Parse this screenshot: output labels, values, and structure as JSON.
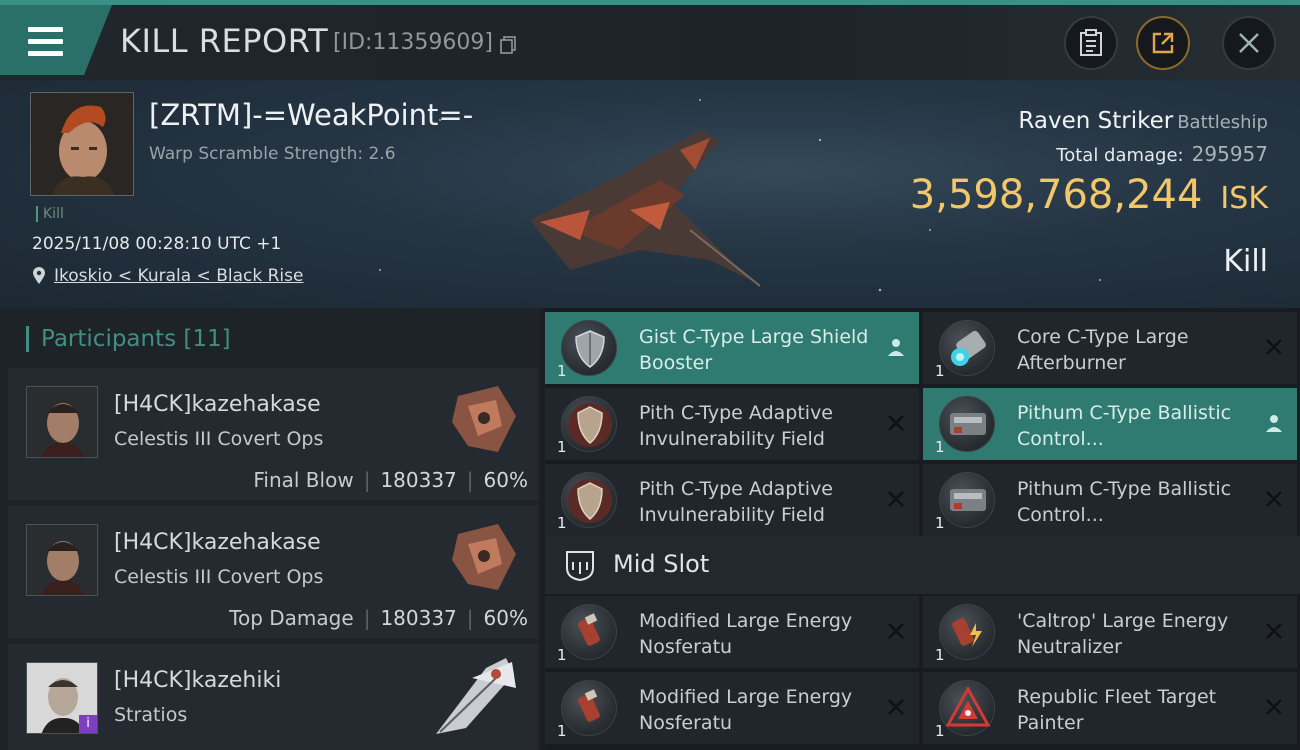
{
  "topbar": {
    "title": "KILL REPORT",
    "report_id": "[ID:11359609]"
  },
  "victim": {
    "name": "[ZRTM]-=WeakPoint=-",
    "subtitle": "Warp Scramble Strength: 2.6",
    "tag": "Kill",
    "datetime": "2025/11/08 00:28:10 UTC +1",
    "location": "Ikoskio < Kurala < Black Rise",
    "ship_name": "Raven Striker",
    "ship_class": "Battleship",
    "total_damage_label": "Total damage:",
    "total_damage": "295957",
    "isk_value": "3,598,768,244",
    "isk_unit": "ISK",
    "result": "Kill"
  },
  "participants": {
    "heading": "Participants",
    "count": "[11]",
    "items": [
      {
        "name": "[H4CK]kazehakase",
        "ship": "Celestis III Covert Ops",
        "role": "Final Blow",
        "damage": "180337",
        "percent": "60%"
      },
      {
        "name": "[H4CK]kazehakase",
        "ship": "Celestis III Covert Ops",
        "role": "Top Damage",
        "damage": "180337",
        "percent": "60%"
      },
      {
        "name": "[H4CK]kazehiki",
        "ship": "Stratios",
        "role": "",
        "damage": "",
        "percent": ""
      }
    ]
  },
  "fitting": {
    "top_slots": [
      {
        "qty": "1",
        "name": "Gist C-Type Large Shield Booster",
        "highlight": true,
        "action": "person-icon"
      },
      {
        "qty": "1",
        "name": "Core C-Type Large Afterburner",
        "highlight": false,
        "action": "close-icon"
      },
      {
        "qty": "1",
        "name": "Pith C-Type Adaptive Invulnerability Field",
        "highlight": false,
        "action": "close-icon"
      },
      {
        "qty": "1",
        "name": "Pithum C-Type Ballistic Control...",
        "highlight": true,
        "action": "person-icon"
      },
      {
        "qty": "1",
        "name": "Pith C-Type Adaptive Invulnerability Field",
        "highlight": false,
        "action": "close-icon"
      },
      {
        "qty": "1",
        "name": "Pithum C-Type Ballistic Control...",
        "highlight": false,
        "action": "close-icon"
      }
    ],
    "mid_slot_heading": "Mid Slot",
    "mid_slots": [
      {
        "qty": "1",
        "name": "Modified Large Energy Nosferatu",
        "action": "close-icon"
      },
      {
        "qty": "1",
        "name": "'Caltrop' Large Energy Neutralizer",
        "action": "close-icon"
      },
      {
        "qty": "1",
        "name": "Modified Large Energy Nosferatu",
        "action": "close-icon"
      },
      {
        "qty": "1",
        "name": "Republic Fleet Target Painter",
        "action": "close-icon"
      }
    ]
  },
  "colors": {
    "accent": "#3a8f86",
    "highlight_row": "#2f7a71",
    "isk_gold": "#f1c76a"
  }
}
